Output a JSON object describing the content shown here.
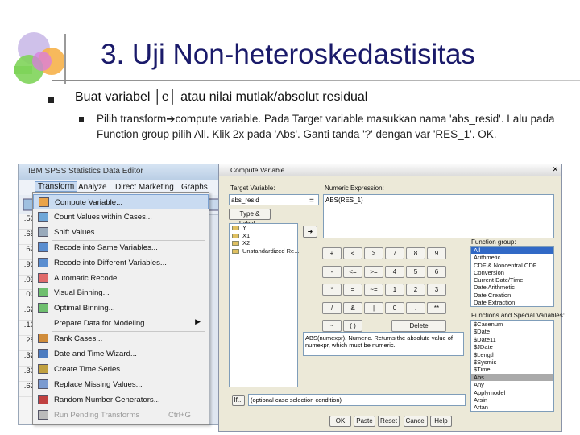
{
  "slide": {
    "title": "3. Uji Non-heteroskedastisitas",
    "bullet1": "Buat variabel │e│ atau nilai mutlak/absolut residual",
    "bullet2": "Pilih transform➔compute variable. Pada Target variable masukkan nama 'abs_resid'. Lalu pada Function group pilih All. Klik 2x pada 'Abs'. Ganti tanda '?' dengan var 'RES_1'. OK."
  },
  "spss": {
    "window_title": "IBM SPSS Statistics Data Editor",
    "menu": [
      "Transform",
      "Analyze",
      "Direct Marketing",
      "Graphs"
    ],
    "row_values": [
      ".50",
      ".65",
      ".62",
      ".90",
      ".03",
      ".00",
      ".62",
      ".10",
      ".25",
      ".32",
      ".30",
      ".62"
    ],
    "right_values": [
      "5",
      "5",
      "6",
      "8",
      "au",
      "au",
      "au",
      "au",
      "5",
      "7",
      "6",
      "6"
    ]
  },
  "transform_menu": {
    "items": [
      {
        "label": "Compute Variable...",
        "highlight": true
      },
      {
        "label": "Count Values within Cases..."
      },
      {
        "label": "Shift Values..."
      },
      {
        "label": "Recode into Same Variables..."
      },
      {
        "label": "Recode into Different Variables..."
      },
      {
        "label": "Automatic Recode..."
      },
      {
        "label": "Visual Binning..."
      },
      {
        "label": "Optimal Binning..."
      },
      {
        "label": "Prepare Data for Modeling",
        "submenu": true
      },
      {
        "label": "Rank Cases..."
      },
      {
        "label": "Date and Time Wizard..."
      },
      {
        "label": "Create Time Series..."
      },
      {
        "label": "Replace Missing Values..."
      },
      {
        "label": "Random Number Generators..."
      },
      {
        "label": "Run Pending Transforms",
        "shortcut": "Ctrl+G",
        "disabled": true
      }
    ]
  },
  "dialog": {
    "title": "Compute Variable",
    "target_label": "Target Variable:",
    "target_value": "abs_resid",
    "equals": "=",
    "numeric_label": "Numeric Expression:",
    "numeric_value": "ABS(RES_1)",
    "type_label_button": "Type & Label...",
    "variables": [
      "Y",
      "X1",
      "X2",
      "Unstandardized Re..."
    ],
    "keypad": [
      "+",
      "<",
      ">",
      "7",
      "8",
      "9",
      "-",
      "<=",
      ">=",
      "4",
      "5",
      "6",
      "*",
      "=",
      "~=",
      "1",
      "2",
      "3",
      "/",
      "&",
      "|",
      "0",
      ".",
      "**",
      "~",
      "( )",
      "Delete"
    ],
    "function_group_label": "Function group:",
    "function_groups": [
      "All",
      "Arithmetic",
      "CDF & Noncentral CDF",
      "Conversion",
      "Current Date/Time",
      "Date Arithmetic",
      "Date Creation",
      "Date Extraction"
    ],
    "description": "ABS(numexpr). Numeric. Returns the absolute value of numexpr, which must be numeric.",
    "functions_label": "Functions and Special Variables:",
    "functions": [
      "$Casenum",
      "$Date",
      "$Date11",
      "$JDate",
      "$Length",
      "$Sysmis",
      "$Time",
      "Abs",
      "Any",
      "Applymodel",
      "Arsin",
      "Artan"
    ],
    "if_button": "If...",
    "if_text": "(optional case selection condition)",
    "buttons": [
      "OK",
      "Paste",
      "Reset",
      "Cancel",
      "Help"
    ]
  }
}
